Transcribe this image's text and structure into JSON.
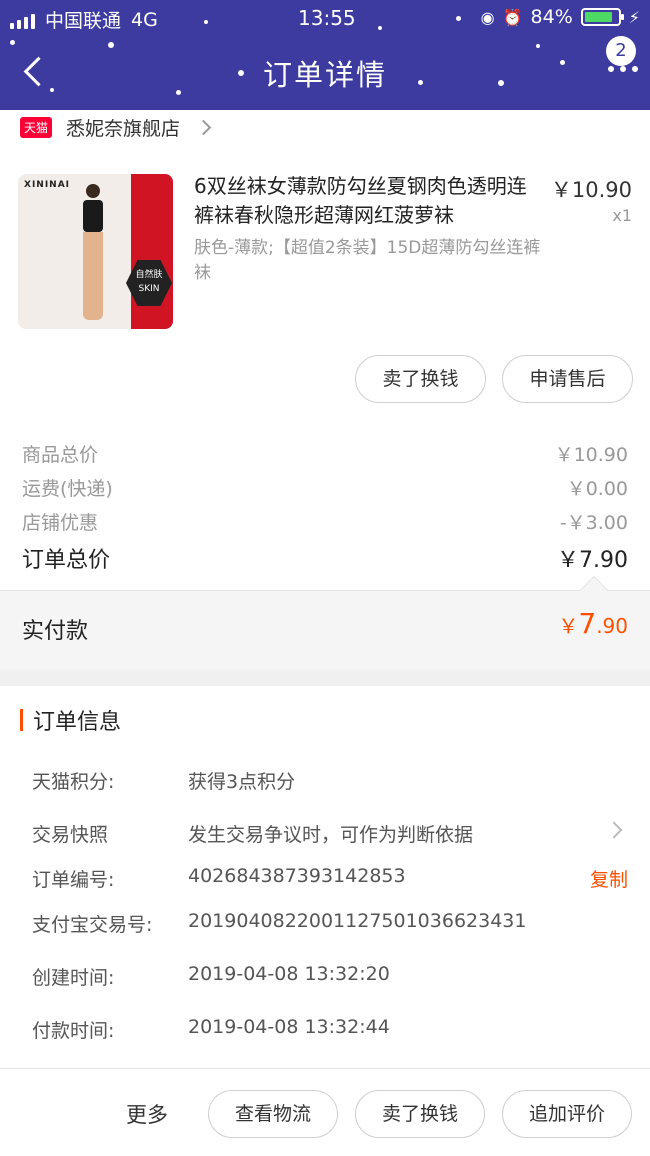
{
  "status_bar": {
    "carrier": "中国联通",
    "network": "4G",
    "time": "13:55",
    "battery": "84%"
  },
  "header": {
    "title": "订单详情",
    "badge_count": "2"
  },
  "shop": {
    "name": "悉妮奈旗舰店",
    "platform_logo": "天猫"
  },
  "product": {
    "image_brand": "XININAI",
    "image_tag_line1": "自然肤",
    "image_tag_line2": "SKIN",
    "title": "6双丝袜女薄款防勾丝夏钢肉色透明连裤袜春秋隐形超薄网红菠萝袜",
    "sku": "肤色-薄款;【超值2条装】15D超薄防勾丝连裤袜",
    "price": "￥10.90",
    "quantity": "x1"
  },
  "item_actions": {
    "sell_label": "卖了换钱",
    "after_sale_label": "申请售后"
  },
  "summary": {
    "goods_total_label": "商品总价",
    "goods_total_value": "￥10.90",
    "shipping_label": "运费(快递)",
    "shipping_value": "￥0.00",
    "discount_label": "店铺优惠",
    "discount_value": "-￥3.00",
    "order_total_label": "订单总价",
    "order_total_value": "￥7.90",
    "paid_label": "实付款",
    "paid_currency": "￥",
    "paid_int": "7",
    "paid_dec": ".90"
  },
  "order_info": {
    "section_title": "订单信息",
    "points_label": "天猫积分:",
    "points_value": "获得3点积分",
    "snapshot_label": "交易快照",
    "snapshot_value": "发生交易争议时，可作为判断依据",
    "order_no_label": "订单编号:",
    "order_no_value": "402684387393142853",
    "copy_label": "复制",
    "alipay_label": "支付宝交易号:",
    "alipay_value": "2019040822001127501036623431",
    "created_label": "创建时间:",
    "created_value": "2019-04-08 13:32:20",
    "paid_time_label": "付款时间:",
    "paid_time_value": "2019-04-08 13:32:44"
  },
  "bottom_bar": {
    "more_label": "更多",
    "logistics_label": "查看物流",
    "sell_label": "卖了换钱",
    "review_label": "追加评价"
  },
  "colors": {
    "header_bg": "#3d3ba0",
    "accent": "#ff5000",
    "tmall_red": "#ff0036"
  }
}
